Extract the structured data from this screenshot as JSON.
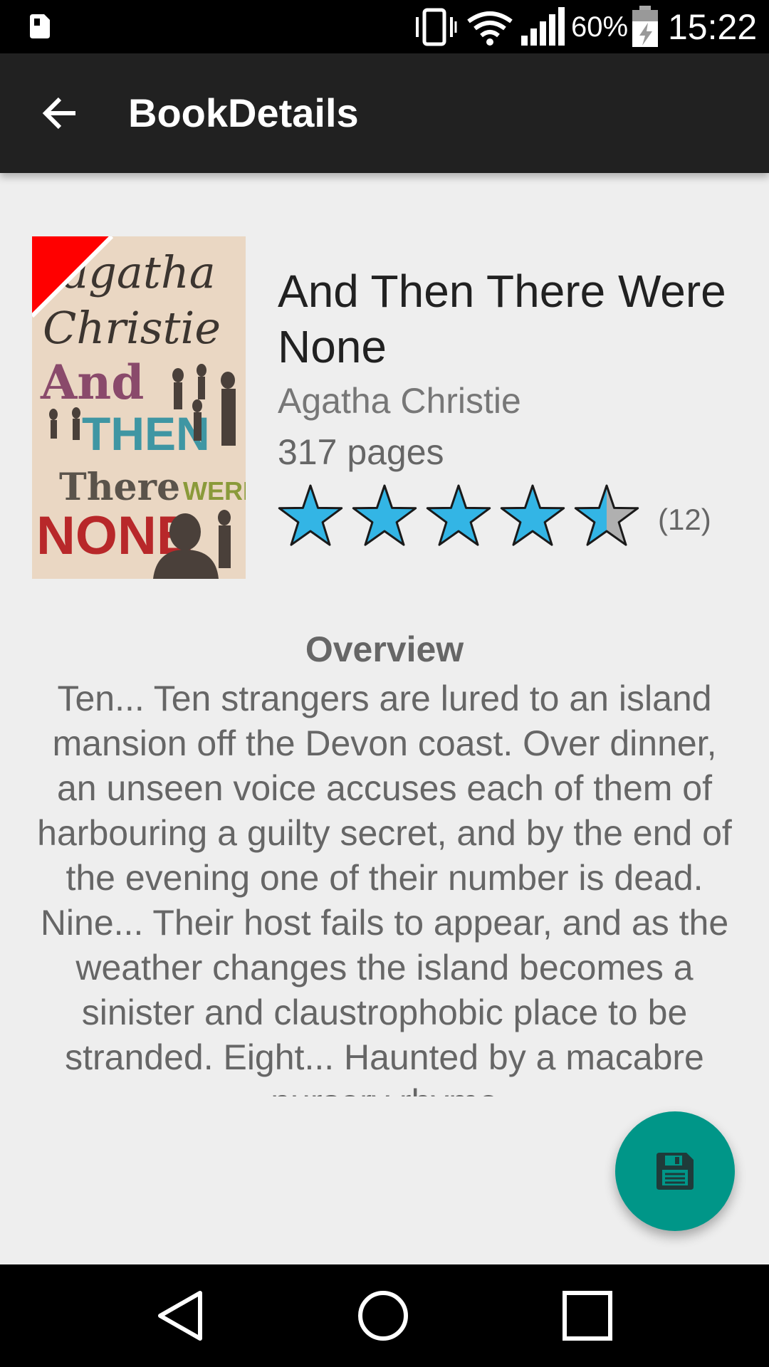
{
  "status_bar": {
    "battery_percent": "60%",
    "time": "15:22",
    "icons": [
      "sim-icon",
      "vibrate-icon",
      "wifi-icon",
      "signal-icon",
      "battery-charging-icon"
    ]
  },
  "app_bar": {
    "title": "BookDetails",
    "back_icon": "arrow-back-icon"
  },
  "book": {
    "title": "And Then There Were None",
    "author": "Agatha Christie",
    "pages": "317 pages",
    "rating": 4.5,
    "rating_max": 5,
    "rating_count": "(12)",
    "star_color": "#33b5e5",
    "star_empty_color": "#b0b0b0",
    "cover_text": [
      "agatha",
      "Christie",
      "And",
      "THEN",
      "There",
      "WERE",
      "NONE"
    ]
  },
  "overview": {
    "heading": "Overview",
    "text": "Ten... Ten strangers are lured to an island mansion off the Devon coast. Over dinner, an unseen voice accuses each of them of harbouring a guilty secret, and by the end of the evening one of their number is dead. Nine... Their host fails to appear, and as the weather changes the island becomes a sinister and claustrophobic place to be stranded. Eight... Haunted by a macabre nursery rhyme"
  },
  "fab": {
    "icon": "save-icon",
    "color": "#009688"
  },
  "nav_bar": {
    "icons": [
      "nav-back-icon",
      "nav-home-icon",
      "nav-recents-icon"
    ]
  }
}
